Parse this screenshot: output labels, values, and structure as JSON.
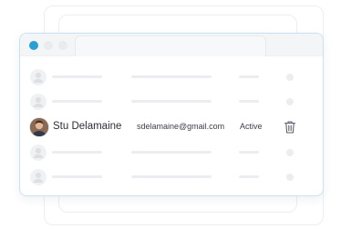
{
  "window": {
    "accent_color": "#2a9fd6"
  },
  "users": [
    {
      "placeholder": true
    },
    {
      "placeholder": true
    },
    {
      "placeholder": false,
      "name": "Stu Delamaine",
      "email": "sdelamaine@gmail.com",
      "status": "Active",
      "action_icon": "trash-icon"
    },
    {
      "placeholder": true
    },
    {
      "placeholder": true
    }
  ],
  "icons": {
    "avatar_placeholder": "user-silhouette-icon",
    "delete": "trash-icon"
  }
}
